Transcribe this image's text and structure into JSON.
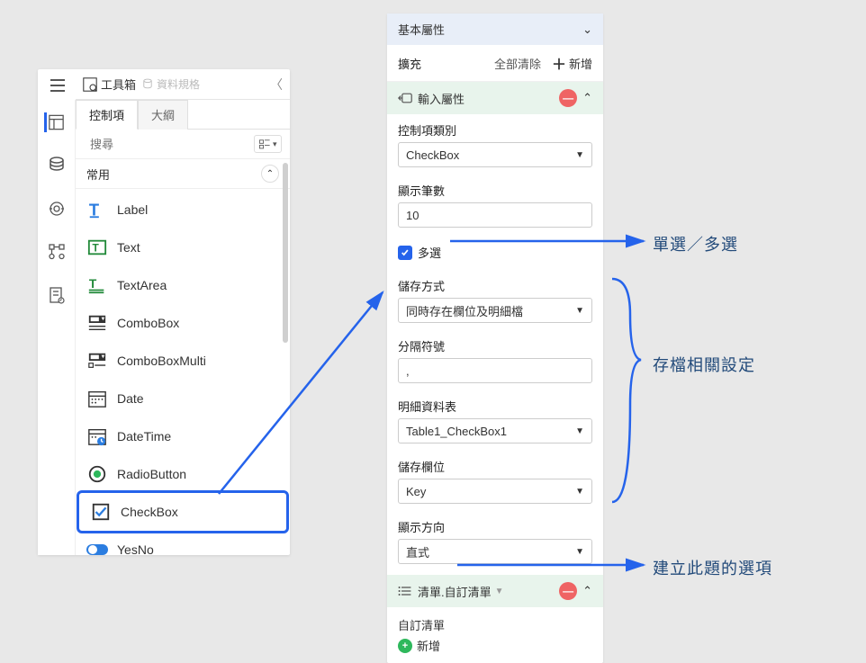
{
  "toolbox": {
    "title": "工具箱",
    "spec": "資料規格",
    "tabs": {
      "control": "控制項",
      "outline": "大綱"
    },
    "search_placeholder": "搜尋",
    "group_common": "常用",
    "items": {
      "label": "Label",
      "text": "Text",
      "textarea": "TextArea",
      "combobox": "ComboBox",
      "comboboxmulti": "ComboBoxMulti",
      "date": "Date",
      "datetime": "DateTime",
      "radiobutton": "RadioButton",
      "checkbox": "CheckBox",
      "yesno": "YesNo"
    }
  },
  "props": {
    "basic_title": "基本屬性",
    "ext": "擴充",
    "clear_all": "全部清除",
    "add_new": "新增",
    "input_title": "輸入屬性",
    "control_type_label": "控制項類別",
    "control_type_value": "CheckBox",
    "count_label": "顯示筆數",
    "count_value": "10",
    "multi_label": "多選",
    "save_mode_label": "儲存方式",
    "save_mode_value": "同時存在欄位及明細檔",
    "sep_label": "分隔符號",
    "sep_value": ",",
    "detail_table_label": "明細資料表",
    "detail_table_value": "Table1_CheckBox1",
    "save_field_label": "儲存欄位",
    "save_field_value": "Key",
    "direction_label": "顯示方向",
    "direction_value": "直式",
    "list_title": "清單.自訂清單",
    "custom_list_label": "自訂清單",
    "add_item": "新增"
  },
  "annotations": {
    "single_multi": "單選／多選",
    "save_related": "存檔相關設定",
    "create_options": "建立此題的選項"
  }
}
